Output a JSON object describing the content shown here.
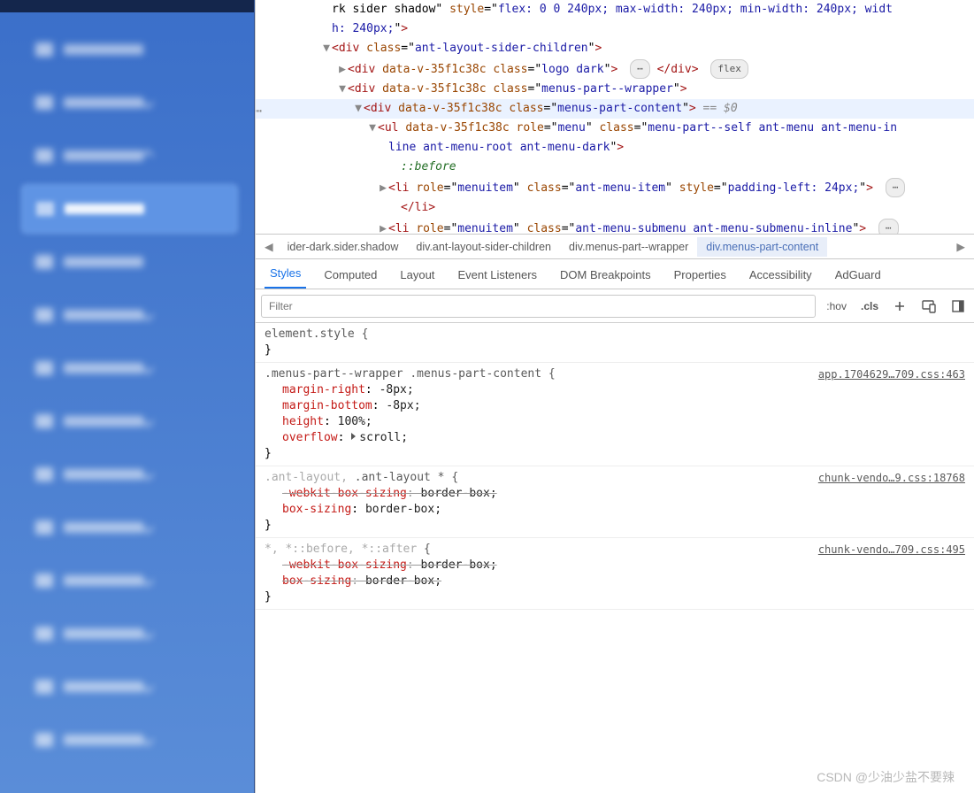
{
  "sidebar": {
    "items": [
      {
        "selected": false,
        "expandable": false
      },
      {
        "selected": false,
        "expandable": true,
        "dir": "down"
      },
      {
        "selected": false,
        "expandable": true,
        "dir": "up"
      },
      {
        "selected": true,
        "expandable": false
      },
      {
        "selected": false,
        "expandable": false
      },
      {
        "selected": false,
        "expandable": true,
        "dir": "down"
      },
      {
        "selected": false,
        "expandable": true,
        "dir": "down"
      },
      {
        "selected": false,
        "expandable": true,
        "dir": "down"
      },
      {
        "selected": false,
        "expandable": true,
        "dir": "down"
      },
      {
        "selected": false,
        "expandable": true,
        "dir": "down"
      },
      {
        "selected": false,
        "expandable": true,
        "dir": "down"
      },
      {
        "selected": false,
        "expandable": true,
        "dir": "down"
      },
      {
        "selected": false,
        "expandable": true,
        "dir": "down"
      },
      {
        "selected": false,
        "expandable": true,
        "dir": "down"
      }
    ]
  },
  "dom": {
    "lines": [
      {
        "indent": 68,
        "tw": "",
        "html": "rk sider shadow\" <span class='attrname'>style</span>=\"<span class='attrval'>flex: 0 0 240px; max-width: 240px; min-width: 240px; widt</span>"
      },
      {
        "indent": 68,
        "tw": "",
        "html": "<span class='attrval'>h: 240px;</span>\"<span class='tag'>&gt;</span>"
      },
      {
        "indent": 68,
        "tw": "▼",
        "html": "<span class='tag'>&lt;div</span> <span class='attrname'>class</span>=\"<span class='attrval'>ant-layout-sider-children</span>\"<span class='tag'>&gt;</span>"
      },
      {
        "indent": 86,
        "tw": "▶",
        "html": "<span class='tag'>&lt;div</span> <span class='attrname'>data-v-35f1c38c</span> <span class='attrname'>class</span>=\"<span class='attrval'>logo dark</span>\"<span class='tag'>&gt;</span> <span class='badge'>⋯</span> <span class='tag'>&lt;/div&gt;</span> <span class='badge'>flex</span>"
      },
      {
        "indent": 86,
        "tw": "▼",
        "html": "<span class='tag'>&lt;div</span> <span class='attrname'>data-v-35f1c38c</span> <span class='attrname'>class</span>=\"<span class='attrval'>menus-part--wrapper</span>\"<span class='tag'>&gt;</span>"
      },
      {
        "indent": 104,
        "tw": "▼",
        "selected": true,
        "html": "<span class='tag'>&lt;div</span> <span class='attrname'>data-v-35f1c38c</span> <span class='attrname'>class</span>=\"<span class='attrval'>menus-part-content</span>\"<span class='tag'>&gt;</span> <span class='eq'>== $0</span>"
      },
      {
        "indent": 120,
        "tw": "▼",
        "html": "<span class='tag'>&lt;ul</span> <span class='attrname'>data-v-35f1c38c</span> <span class='attrname'>role</span>=\"<span class='attrval'>menu</span>\" <span class='attrname'>class</span>=\"<span class='attrval'>menu-part--self ant-menu ant-menu-in</span>"
      },
      {
        "indent": 132,
        "tw": "",
        "html": "<span class='attrval'>line ant-menu-root ant-menu-dark</span>\"<span class='tag'>&gt;</span>"
      },
      {
        "indent": 146,
        "tw": "",
        "html": "<span class='pseudo'>::before</span>"
      },
      {
        "indent": 132,
        "tw": "▶",
        "html": "<span class='tag'>&lt;li</span> <span class='attrname'>role</span>=\"<span class='attrval'>menuitem</span>\" <span class='attrname'>class</span>=\"<span class='attrval'>ant-menu-item</span>\" <span class='attrname'>style</span>=\"<span class='attrval'>padding-left: 24px;</span>\"<span class='tag'>&gt;</span> <span class='badge'>⋯</span>"
      },
      {
        "indent": 146,
        "tw": "",
        "html": "<span class='tag'>&lt;/li&gt;</span>"
      },
      {
        "indent": 132,
        "tw": "▶",
        "html": "<span class='tag'>&lt;li</span> <span class='attrname'>role</span>=\"<span class='attrval'>menuitem</span>\" <span class='attrname'>class</span>=\"<span class='attrval'>ant-menu-submenu ant-menu-submenu-inline</span>\"<span class='tag'>&gt;</span> <span class='badge'>⋯</span>"
      }
    ]
  },
  "breadcrumb": {
    "nav_left": "◀",
    "nav_right": "▶",
    "items": [
      {
        "label": "ider-dark.sider.shadow",
        "sel": false
      },
      {
        "label": "div.ant-layout-sider-children",
        "sel": false
      },
      {
        "label": "div.menus-part--wrapper",
        "sel": false
      },
      {
        "label": "div.menus-part-content",
        "sel": true
      }
    ]
  },
  "tabs": [
    "Styles",
    "Computed",
    "Layout",
    "Event Listeners",
    "DOM Breakpoints",
    "Properties",
    "Accessibility",
    "AdGuard"
  ],
  "active_tab": "Styles",
  "filter_placeholder": "Filter",
  "toolbar": {
    "hov": ":hov",
    "cls": ".cls"
  },
  "rules": [
    {
      "selector": "element.style {",
      "src": "",
      "props": [],
      "close": "}"
    },
    {
      "selector": ".menus-part--wrapper .menus-part-content {",
      "src": "app.1704629…709.css:463",
      "props": [
        {
          "n": "margin-right",
          "v": "-8px;"
        },
        {
          "n": "margin-bottom",
          "v": "-8px;"
        },
        {
          "n": "height",
          "v": "100%;"
        },
        {
          "n": "overflow",
          "v": "scroll;",
          "tri": true
        }
      ],
      "close": "}"
    },
    {
      "selector": "<span class='dim'>.ant-layout,</span> .ant-layout * {",
      "src": "chunk-vendo…9.css:18768",
      "props": [
        {
          "n": "-webkit-box-sizing",
          "v": "border-box;",
          "strike": true
        },
        {
          "n": "box-sizing",
          "v": "border-box;"
        }
      ],
      "close": "}"
    },
    {
      "selector": "<span class='dim'>*, *::before, *::after</span> {",
      "src": "chunk-vendo…709.css:495",
      "props": [
        {
          "n": "-webkit-box-sizing",
          "v": "border-box;",
          "strike": true
        },
        {
          "n": "box-sizing",
          "v": "border-box;",
          "strike": true
        }
      ],
      "close": "}"
    }
  ],
  "watermark": "CSDN @少油少盐不要辣"
}
